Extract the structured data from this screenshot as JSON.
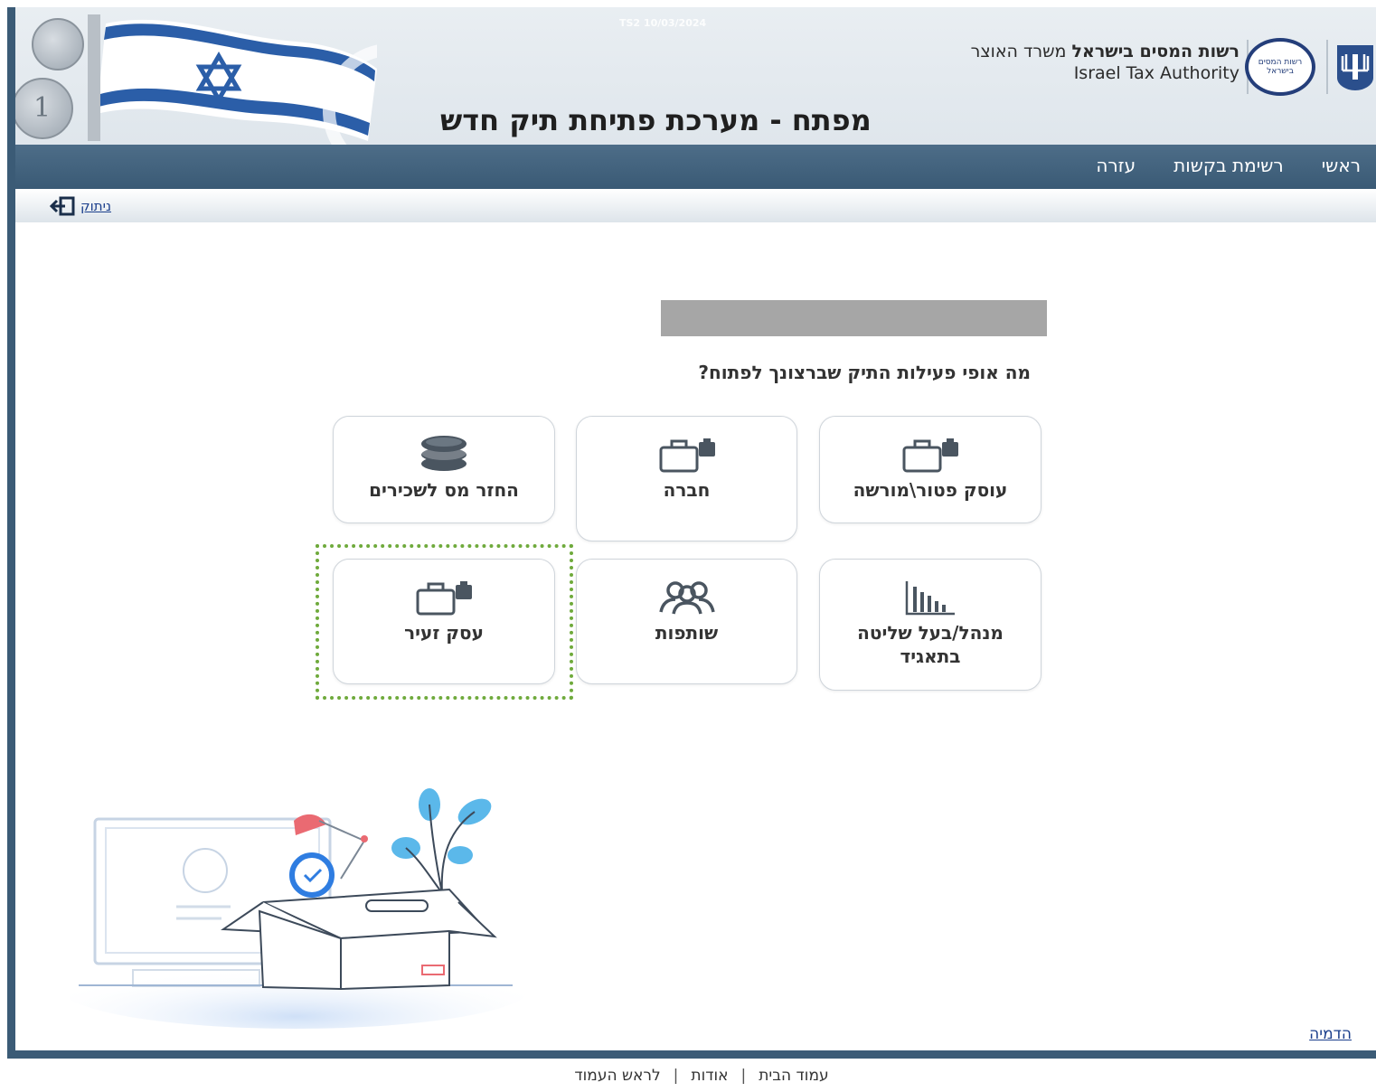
{
  "header": {
    "watermark": "TS2 10/03/2024",
    "org_name_bold": "רשות המסים בישראל",
    "org_name_regular": " משרד האוצר",
    "org_name_en": "Israel Tax Authority",
    "logo_text": "רשות המסים בישראל",
    "title": "מפתח - מערכת פתיחת תיק חדש"
  },
  "nav": {
    "items": [
      {
        "label": "ראשי"
      },
      {
        "label": "רשימת בקשות"
      },
      {
        "label": "עזרה"
      }
    ]
  },
  "logout": {
    "label": "ניתוק"
  },
  "main": {
    "question": "מה אופי פעילות התיק שברצונך לפתוח?",
    "options": [
      {
        "label": "עוסק פטור\\מורשה",
        "icon": "briefcase-icon"
      },
      {
        "label": "חברה",
        "icon": "briefcase-icon"
      },
      {
        "label": "החזר מס לשכירים",
        "icon": "coins-icon"
      },
      {
        "label": "מנהל/בעל שליטה בתאגיד",
        "icon": "bar-chart-icon"
      },
      {
        "label": "שותפות",
        "icon": "people-icon"
      },
      {
        "label": "עסק זעיר",
        "icon": "briefcase-icon"
      }
    ]
  },
  "simulation_link": "הדמיה",
  "footer": {
    "home": "עמוד הבית",
    "about": "אודות",
    "top": "לראש העמוד",
    "separator": "|"
  },
  "colors": {
    "nav_bg": "#3b5b76",
    "link": "#1a3e8c",
    "highlight": "#6faa3c",
    "placeholder_bar": "#a6a6a6"
  }
}
